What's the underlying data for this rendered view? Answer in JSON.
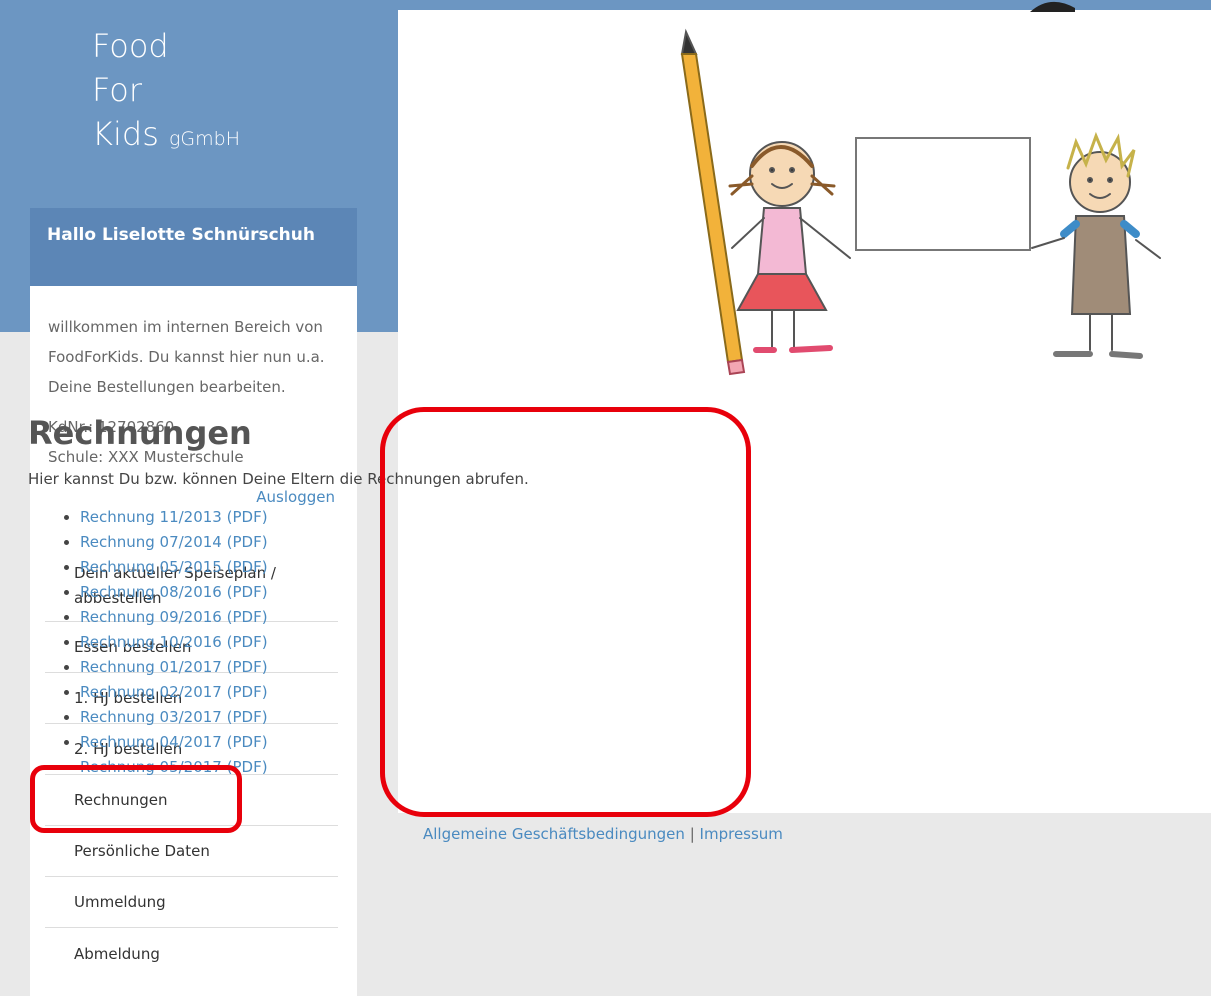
{
  "logo": {
    "line1": "Food",
    "line2": "For",
    "line3": "Kids",
    "suffix": "gGmbH"
  },
  "sidebar": {
    "greeting": "Hallo Liselotte Schnürschuh",
    "welcome": "willkommen im internen Bereich von FoodForKids. Du kannst hier nun u.a. Deine Bestellungen bearbeiten.",
    "customer_no": "KdNr.: 12702860",
    "school": "Schule: XXX Musterschule",
    "logout": "Ausloggen",
    "menu": [
      {
        "label": "Dein aktueller Speiseplan / abbestellen"
      },
      {
        "label": "Essen bestellen"
      },
      {
        "label": "1. HJ bestellen"
      },
      {
        "label": "2. HJ bestellen"
      },
      {
        "label": "Rechnungen"
      },
      {
        "label": "Persönliche Daten"
      },
      {
        "label": "Ummeldung"
      },
      {
        "label": "Abmeldung"
      }
    ]
  },
  "main": {
    "heading": "Rechnungen",
    "intro": "Hier kannst Du bzw. können Deine Eltern die Rechnungen abrufen.",
    "invoices": [
      {
        "label": "Rechnung 11/2013 (PDF)"
      },
      {
        "label": "Rechnung 07/2014 (PDF)"
      },
      {
        "label": "Rechnung 05/2015 (PDF)"
      },
      {
        "label": "Rechnung 08/2016 (PDF)"
      },
      {
        "label": "Rechnung 09/2016 (PDF)"
      },
      {
        "label": "Rechnung 10/2016 (PDF)"
      },
      {
        "label": "Rechnung 01/2017 (PDF)"
      },
      {
        "label": "Rechnung 02/2017 (PDF)"
      },
      {
        "label": "Rechnung 03/2017 (PDF)"
      },
      {
        "label": "Rechnung 04/2017 (PDF)"
      },
      {
        "label": "Rechnung 05/2017 (PDF)"
      }
    ]
  },
  "footer": {
    "agb": "Allgemeine Geschäftsbedingungen",
    "separator": "|",
    "impressum": "Impressum"
  },
  "colors": {
    "header_blue": "#6c96c2",
    "panel_blue": "#5c86b6",
    "link_blue": "#4a8ac0",
    "highlight_red": "#e8000b"
  }
}
